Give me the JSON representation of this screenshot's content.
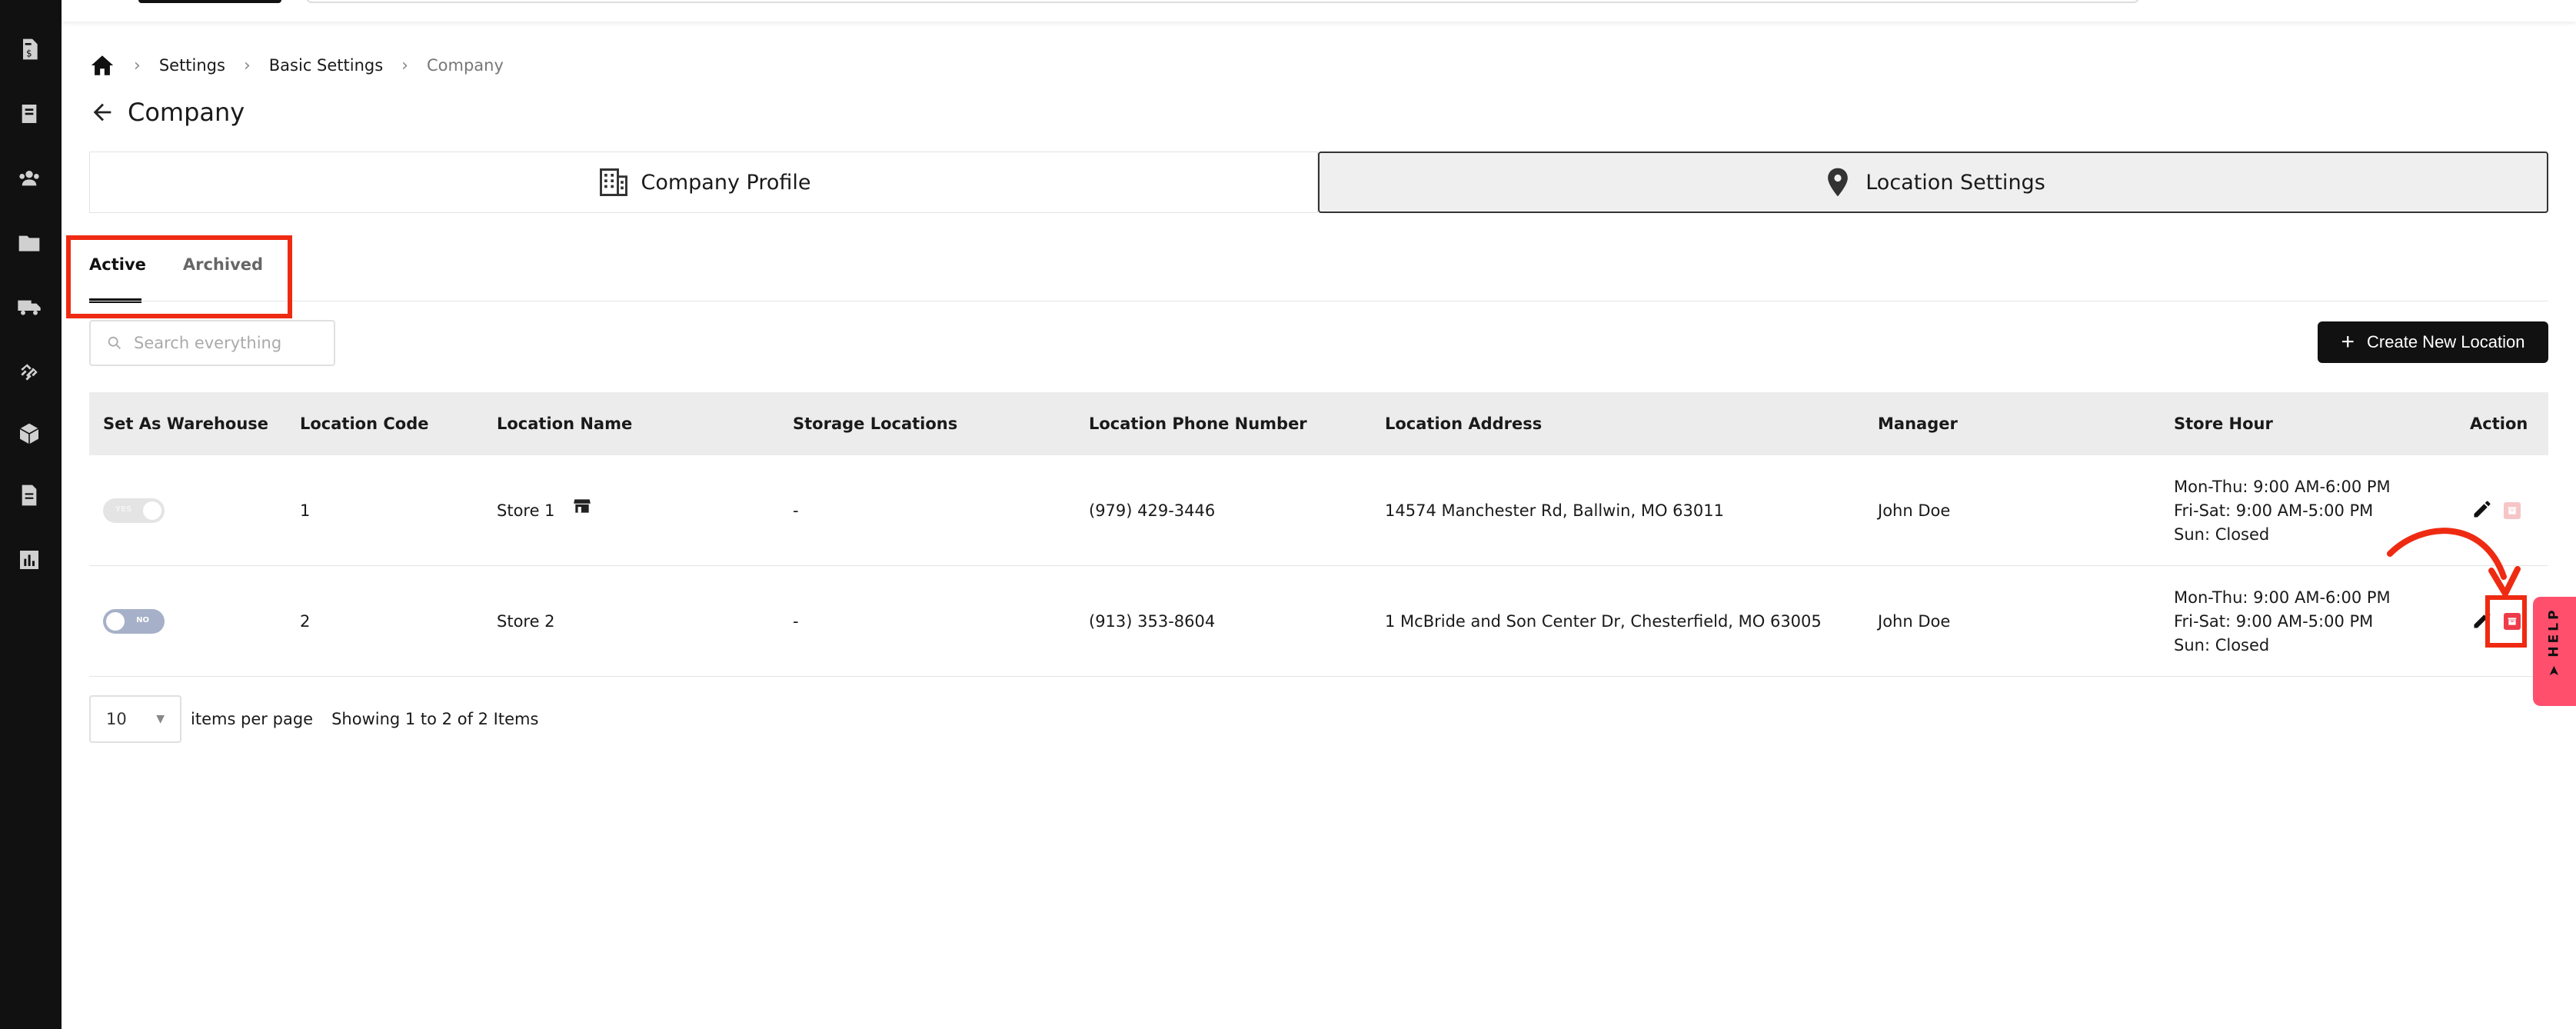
{
  "breadcrumb": {
    "items": [
      "Settings",
      "Basic Settings",
      "Company"
    ]
  },
  "page": {
    "title": "Company"
  },
  "main_tabs": [
    {
      "label": "Company Profile",
      "icon": "building-icon",
      "active": false
    },
    {
      "label": "Location Settings",
      "icon": "map-pin-icon",
      "active": true
    }
  ],
  "sub_tabs": [
    {
      "label": "Active",
      "active": true
    },
    {
      "label": "Archived",
      "active": false
    }
  ],
  "search": {
    "placeholder": "Search everything"
  },
  "actions": {
    "create_label": "Create New Location"
  },
  "table": {
    "headers": [
      "Set As Warehouse",
      "Location Code",
      "Location Name",
      "Storage Locations",
      "Location Phone Number",
      "Location Address",
      "Manager",
      "Store Hour",
      "Action"
    ],
    "rows": [
      {
        "warehouse_toggle": "YES",
        "code": "1",
        "name": "Store 1",
        "storage": "-",
        "phone": "(979) 429-3446",
        "address": "14574 Manchester Rd, Ballwin, MO 63011",
        "manager": "John Doe",
        "hours": [
          "Mon-Thu: 9:00 AM-6:00 PM",
          "Fri-Sat: 9:00 AM-5:00 PM",
          "Sun: Closed"
        ]
      },
      {
        "warehouse_toggle": "NO",
        "code": "2",
        "name": "Store 2",
        "storage": "-",
        "phone": "(913) 353-8604",
        "address": "1 McBride and Son Center Dr, Chesterfield, MO 63005",
        "manager": "John Doe",
        "hours": [
          "Mon-Thu: 9:00 AM-6:00 PM",
          "Fri-Sat: 9:00 AM-5:00 PM",
          "Sun: Closed"
        ]
      }
    ]
  },
  "pagination": {
    "page_size": "10",
    "per_page_label": "items per page",
    "showing": "Showing 1 to 2 of 2 Items"
  },
  "help": {
    "label": "HELP"
  },
  "colors": {
    "sidebar": "#111111",
    "primary_button": "#111111",
    "annotation": "#ee2b12",
    "help_tab": "#ff4f6d",
    "archive": "#ee3b4a"
  }
}
